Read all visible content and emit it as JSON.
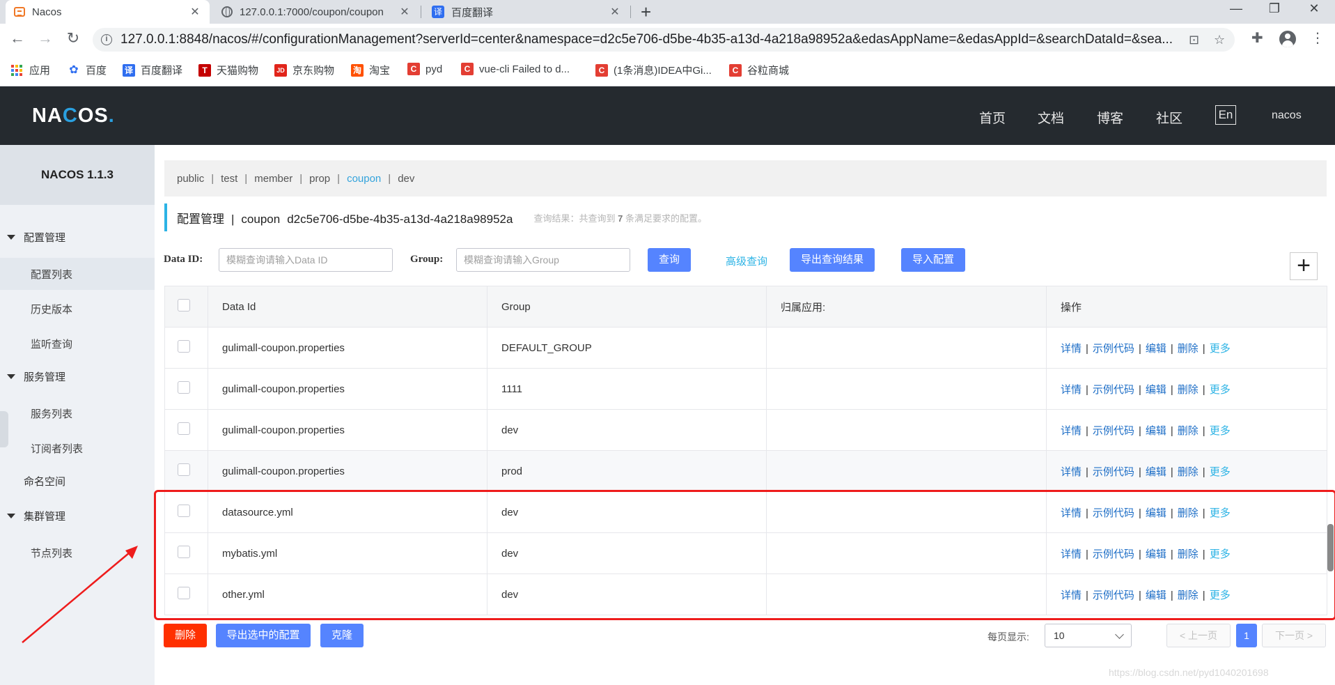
{
  "browser": {
    "tabs": [
      {
        "title": "Nacos",
        "active": true
      },
      {
        "title": "127.0.0.1:7000/coupon/coupon",
        "active": false
      },
      {
        "title": "百度翻译",
        "active": false
      }
    ],
    "url": "127.0.0.1:8848/nacos/#/configurationManagement?serverId=center&namespace=d2c5e706-d5be-4b35-a13d-4a218a98952a&edasAppName=&edasAppId=&searchDataId=&sea...",
    "bookmarks": [
      {
        "label": "应用",
        "icon": "apps-icon"
      },
      {
        "label": "百度",
        "icon": "baidu-paw-icon",
        "icon_color": "#2f6ef0"
      },
      {
        "label": "百度翻译",
        "icon": "translate-icon",
        "icon_color": "#2f6ef0",
        "glyph": "译"
      },
      {
        "label": "天猫购物",
        "icon": "tmall-icon",
        "icon_color": "#c40000",
        "glyph": "T"
      },
      {
        "label": "京东购物",
        "icon": "jd-icon",
        "icon_color": "#e1251b",
        "glyph": "JD"
      },
      {
        "label": "淘宝",
        "icon": "taobao-icon",
        "icon_color": "#ff5000",
        "glyph": "淘"
      },
      {
        "label": "pyd",
        "icon": "csdn-icon",
        "icon_color": "#e33e33",
        "glyph": "C"
      },
      {
        "label": "vue-cli Failed to d...",
        "icon": "csdn-icon",
        "icon_color": "#e33e33",
        "glyph": "C"
      },
      {
        "label": "(1条消息)IDEA中Gi...",
        "icon": "csdn-icon",
        "icon_color": "#e33e33",
        "glyph": "C"
      },
      {
        "label": "谷粒商城",
        "icon": "csdn-icon",
        "icon_color": "#e33e33",
        "glyph": "C"
      }
    ]
  },
  "header": {
    "logo": {
      "n": "NA",
      "o": "C",
      "s": "OS",
      "dot": "."
    },
    "nav": [
      "首页",
      "文档",
      "博客",
      "社区"
    ],
    "lang": "En",
    "user": "nacos"
  },
  "sidebar": {
    "version": "NACOS 1.1.3",
    "groups": [
      {
        "label": "配置管理",
        "items": [
          "配置列表",
          "历史版本",
          "监听查询"
        ]
      },
      {
        "label": "服务管理",
        "items": [
          "服务列表",
          "订阅者列表"
        ]
      },
      {
        "label": "命名空间",
        "items": []
      },
      {
        "label": "集群管理",
        "items": [
          "节点列表"
        ]
      }
    ]
  },
  "namespaces": [
    "public",
    "test",
    "member",
    "prop",
    "coupon",
    "dev"
  ],
  "active_namespace": "coupon",
  "page": {
    "title": "配置管理",
    "sep": "|",
    "namespace_name": "coupon",
    "namespace_id": "d2c5e706-d5be-4b35-a13d-4a218a98952a",
    "query_result_prefix": "查询结果：共查询到",
    "query_result_count": "7",
    "query_result_suffix": "条满足要求的配置。"
  },
  "filters": {
    "data_id_label": "Data ID:",
    "data_id_placeholder": "模糊查询请输入Data ID",
    "group_label": "Group:",
    "group_placeholder": "模糊查询请输入Group",
    "search": "查询",
    "advanced": "高级查询",
    "export_results": "导出查询结果",
    "import_config": "导入配置",
    "add": "+"
  },
  "table": {
    "headers": [
      "Data Id",
      "Group",
      "归属应用:",
      "操作"
    ],
    "actions": [
      "详情",
      "示例代码",
      "编辑",
      "删除",
      "更多"
    ],
    "rows": [
      {
        "data_id": "gulimall-coupon.properties",
        "group": "DEFAULT_GROUP",
        "app": ""
      },
      {
        "data_id": "gulimall-coupon.properties",
        "group": "1111",
        "app": ""
      },
      {
        "data_id": "gulimall-coupon.properties",
        "group": "dev",
        "app": ""
      },
      {
        "data_id": "gulimall-coupon.properties",
        "group": "prod",
        "app": ""
      },
      {
        "data_id": "datasource.yml",
        "group": "dev",
        "app": ""
      },
      {
        "data_id": "mybatis.yml",
        "group": "dev",
        "app": ""
      },
      {
        "data_id": "other.yml",
        "group": "dev",
        "app": ""
      }
    ]
  },
  "footer": {
    "delete": "删除",
    "export_selected": "导出选中的配置",
    "clone": "克隆",
    "per_page_label": "每页显示:",
    "per_page": "10",
    "prev": "< 上一页",
    "current_page": "1",
    "next": "下一页 >"
  },
  "watermark": "https://blog.csdn.net/pyd1040201698",
  "colors": {
    "header_bg": "#252a2f",
    "primary": "#5584ff",
    "danger": "#ff3000",
    "link": "#1f6fc7",
    "accent": "#2cb3e5",
    "highlight_annotation": "#ee1c1c"
  }
}
